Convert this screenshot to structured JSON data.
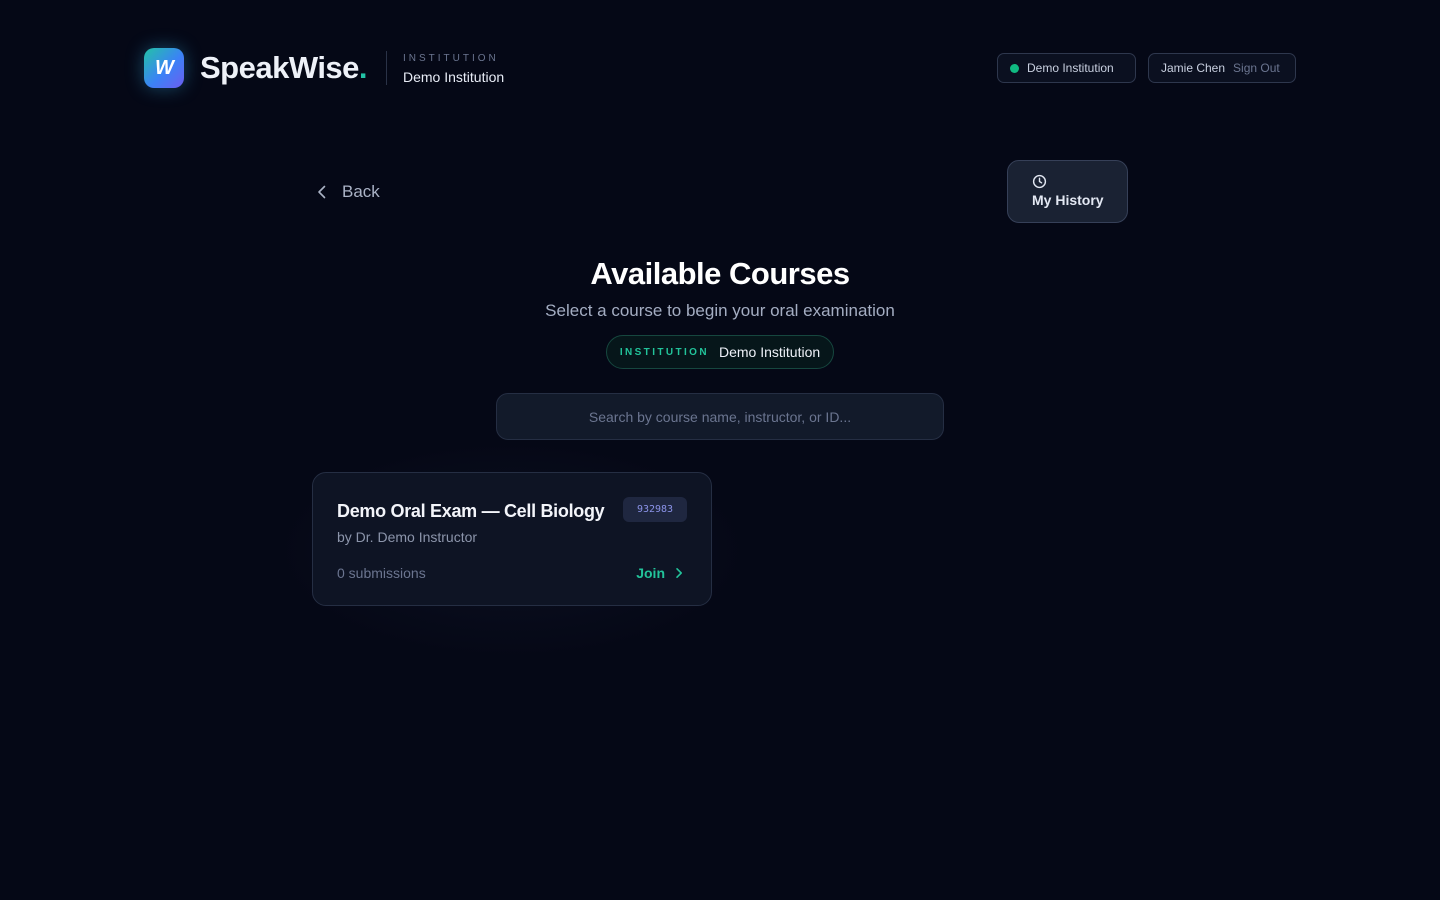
{
  "header": {
    "logo_letter": "W",
    "brand_name": "SpeakWise",
    "brand_dot": ".",
    "institution_label": "INSTITUTION",
    "institution_name": "Demo Institution",
    "status_pill": "Demo Institution",
    "user_name": "Jamie Chen",
    "sign_out_label": "Sign Out"
  },
  "nav": {
    "back_label": "Back",
    "history_label": "My History"
  },
  "main": {
    "title": "Available Courses",
    "subtitle": "Select a course to begin your oral examination",
    "chip_label": "INSTITUTION",
    "chip_value": "Demo Institution"
  },
  "search": {
    "placeholder": "Search by course name, instructor, or ID...",
    "value": ""
  },
  "courses": [
    {
      "title": "Demo Oral Exam — Cell Biology",
      "id": "932983",
      "instructor": "by Dr. Demo Instructor",
      "submissions": "0 submissions",
      "join_label": "Join"
    }
  ],
  "colors": {
    "background": "#050816",
    "accent_green": "#22c39a",
    "status_green": "#10b981",
    "id_badge_text": "#8b93e8"
  },
  "icons": {
    "back": "chevron-left-icon",
    "history": "clock-icon",
    "join": "chevron-right-icon",
    "status": "status-dot-icon"
  }
}
